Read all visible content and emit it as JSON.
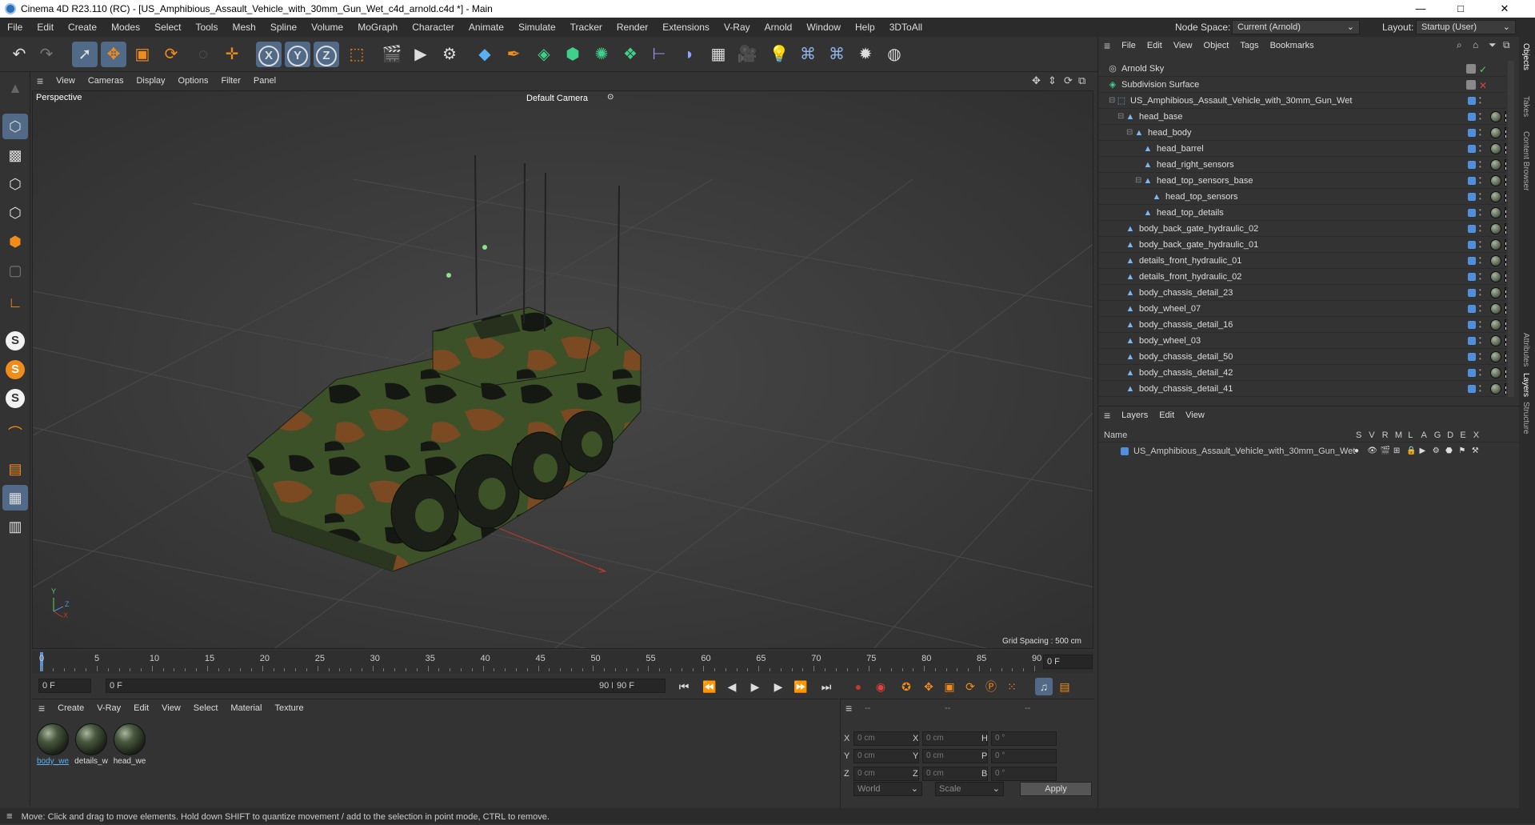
{
  "window": {
    "title": "Cinema 4D R23.110 (RC) - [US_Amphibious_Assault_Vehicle_with_30mm_Gun_Wet_c4d_arnold.c4d *] - Main",
    "minimize": "—",
    "maximize": "□",
    "close": "✕"
  },
  "menubar": {
    "items": [
      "File",
      "Edit",
      "Create",
      "Modes",
      "Select",
      "Tools",
      "Mesh",
      "Spline",
      "Volume",
      "MoGraph",
      "Character",
      "Animate",
      "Simulate",
      "Tracker",
      "Render",
      "Extensions",
      "V-Ray",
      "Arnold",
      "Window",
      "Help",
      "3DToAll"
    ],
    "node_space_label": "Node Space:",
    "node_space_value": "Current (Arnold)",
    "layout_label": "Layout:",
    "layout_value": "Startup (User)"
  },
  "toolbar": {
    "axis_x": "X",
    "axis_y": "Y",
    "axis_z": "Z"
  },
  "viewport": {
    "menu": [
      "View",
      "Cameras",
      "Display",
      "Options",
      "Filter",
      "Panel"
    ],
    "label": "Perspective",
    "camera": "Default Camera",
    "grid_spacing": "Grid Spacing : 500 cm",
    "axis_y": "Y",
    "axis_z": "Z",
    "axis_x": "X"
  },
  "timeline": {
    "ticks": [
      "0",
      "5",
      "10",
      "15",
      "20",
      "25",
      "30",
      "35",
      "40",
      "45",
      "50",
      "55",
      "60",
      "65",
      "70",
      "75",
      "80",
      "85",
      "90"
    ],
    "current_frame": "0 F"
  },
  "transport": {
    "start_field": "0 F",
    "range_start": "0 F",
    "range_end": "90 F",
    "end_field": "90 F"
  },
  "materials": {
    "menu": [
      "Create",
      "V-Ray",
      "Edit",
      "View",
      "Select",
      "Material",
      "Texture"
    ],
    "items": [
      "body_we",
      "details_w",
      "head_we"
    ]
  },
  "coordinates": {
    "header": [
      "--",
      "--",
      "--"
    ],
    "rows": [
      {
        "l1": "X",
        "v1": "0 cm",
        "l2": "X",
        "v2": "0 cm",
        "l3": "H",
        "v3": "0 °"
      },
      {
        "l1": "Y",
        "v1": "0 cm",
        "l2": "Y",
        "v2": "0 cm",
        "l3": "P",
        "v3": "0 °"
      },
      {
        "l1": "Z",
        "v1": "0 cm",
        "l2": "Z",
        "v2": "0 cm",
        "l3": "B",
        "v3": "0 °"
      }
    ],
    "mode1": "World",
    "mode2": "Scale",
    "apply": "Apply"
  },
  "status": "Move: Click and drag to move elements. Hold down SHIFT to quantize movement / add to the selection in point mode, CTRL to remove.",
  "objects": {
    "menu": [
      "File",
      "Edit",
      "View",
      "Object",
      "Tags",
      "Bookmarks"
    ],
    "rows": [
      {
        "name": "Arnold Sky",
        "indent": 0,
        "kind": "sky"
      },
      {
        "name": "Subdivision Surface",
        "indent": 0,
        "kind": "sds"
      },
      {
        "name": "US_Amphibious_Assault_Vehicle_with_30mm_Gun_Wet",
        "indent": 1,
        "kind": "null"
      },
      {
        "name": "head_base",
        "indent": 2,
        "kind": "poly"
      },
      {
        "name": "head_body",
        "indent": 3,
        "kind": "poly"
      },
      {
        "name": "head_barrel",
        "indent": 4,
        "kind": "poly"
      },
      {
        "name": "head_right_sensors",
        "indent": 4,
        "kind": "poly"
      },
      {
        "name": "head_top_sensors_base",
        "indent": 4,
        "kind": "poly"
      },
      {
        "name": "head_top_sensors",
        "indent": 5,
        "kind": "poly"
      },
      {
        "name": "head_top_details",
        "indent": 4,
        "kind": "poly"
      },
      {
        "name": "body_back_gate_hydraulic_02",
        "indent": 2,
        "kind": "poly"
      },
      {
        "name": "body_back_gate_hydraulic_01",
        "indent": 2,
        "kind": "poly"
      },
      {
        "name": "details_front_hydraulic_01",
        "indent": 2,
        "kind": "poly"
      },
      {
        "name": "details_front_hydraulic_02",
        "indent": 2,
        "kind": "poly"
      },
      {
        "name": "body_chassis_detail_23",
        "indent": 2,
        "kind": "poly"
      },
      {
        "name": "body_wheel_07",
        "indent": 2,
        "kind": "poly"
      },
      {
        "name": "body_chassis_detail_16",
        "indent": 2,
        "kind": "poly"
      },
      {
        "name": "body_wheel_03",
        "indent": 2,
        "kind": "poly"
      },
      {
        "name": "body_chassis_detail_50",
        "indent": 2,
        "kind": "poly"
      },
      {
        "name": "body_chassis_detail_42",
        "indent": 2,
        "kind": "poly"
      },
      {
        "name": "body_chassis_detail_41",
        "indent": 2,
        "kind": "poly"
      }
    ]
  },
  "layers": {
    "menu": [
      "Layers",
      "Edit",
      "View"
    ],
    "col_name": "Name",
    "cols": [
      "S",
      "V",
      "R",
      "M",
      "L",
      "A",
      "G",
      "D",
      "E",
      "X"
    ],
    "rows": [
      {
        "name": "US_Amphibious_Assault_Vehicle_with_30mm_Gun_Wet"
      }
    ]
  },
  "right_tabs": [
    "Objects",
    "Takes",
    "Content Browser",
    "Attributes",
    "Layers",
    "Structure"
  ]
}
